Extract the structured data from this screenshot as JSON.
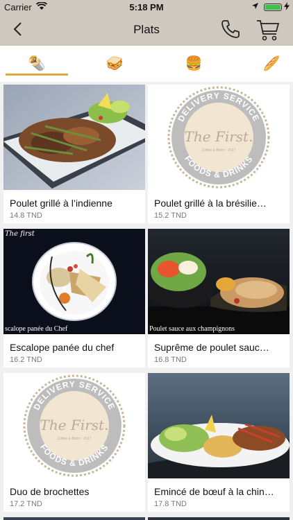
{
  "status": {
    "carrier": "Carrier",
    "time": "5:18 PM"
  },
  "nav": {
    "title": "Plats",
    "back_icon": "chevron-left-icon",
    "phone_icon": "phone-icon",
    "cart_icon": "cart-icon"
  },
  "tabs": [
    {
      "icon": "wrap-icon",
      "glyph": "🌯",
      "active": true
    },
    {
      "icon": "sandwich-icon",
      "glyph": "🥪",
      "active": false
    },
    {
      "icon": "burger-icon",
      "glyph": "🍔",
      "active": false
    },
    {
      "icon": "baguette-icon",
      "glyph": "🥖",
      "active": false
    }
  ],
  "logo": {
    "ring_top": "DELIVERY SERVICE",
    "ring_bottom": "FOODS & DRINKS",
    "brand": "The First.",
    "tagline": "Coffee & Bistro · 2017"
  },
  "dishes": [
    {
      "name": "Poulet grillé à l’indienne",
      "price": "14.8 TND",
      "image": "photo"
    },
    {
      "name": "Poulet grillé à la brésilie…",
      "price": "15.2 TND",
      "image": "logo"
    },
    {
      "name": "Escalope panée du chef",
      "price": "16.2 TND",
      "image": "photo",
      "caption": "scalope panée du Chef",
      "badge": "The first"
    },
    {
      "name": "Suprême de poulet sauc…",
      "price": "16.8 TND",
      "image": "photo",
      "caption": "Poulet sauce aux champignons"
    },
    {
      "name": "Duo de brochettes",
      "price": "17.2 TND",
      "image": "logo"
    },
    {
      "name": "Emincé de bœuf à la chin…",
      "price": "17.8 TND",
      "image": "photo"
    }
  ],
  "colors": {
    "bar": "#cfc8bf",
    "accent": "#e0a83a",
    "battery": "#3cc24a"
  }
}
